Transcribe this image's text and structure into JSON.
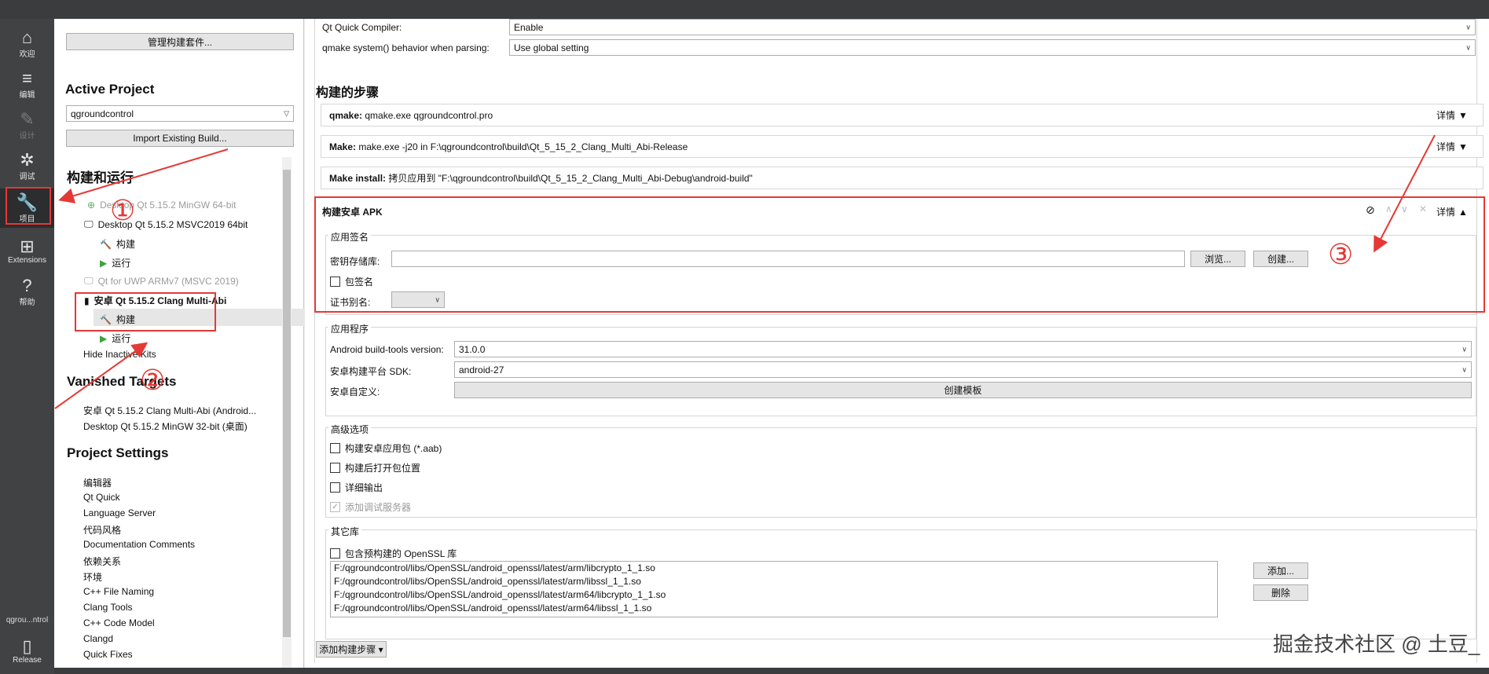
{
  "modes": [
    {
      "label": "欢迎",
      "icon": "home-icon",
      "glyph": "⌂"
    },
    {
      "label": "编辑",
      "icon": "edit-lines-icon",
      "glyph": "≡"
    },
    {
      "label": "设计",
      "icon": "pen-icon",
      "glyph": "✎"
    },
    {
      "label": "调试",
      "icon": "bug-icon",
      "glyph": "✲"
    },
    {
      "label": "项目",
      "icon": "wrench-icon",
      "glyph": "🔧"
    },
    {
      "label": "Extensions",
      "icon": "extensions-icon",
      "glyph": "⊞"
    },
    {
      "label": "帮助",
      "icon": "help-icon",
      "glyph": "?"
    }
  ],
  "target": {
    "project_short": "qgrou...ntrol",
    "config": "Release"
  },
  "left": {
    "manage_kits": "管理构建套件...",
    "active_project_heading": "Active Project",
    "project_combo": "qgroundcontrol",
    "import_build": "Import Existing Build...",
    "build_run_heading": "构建和运行",
    "kits": [
      {
        "label": "Desktop Qt 5.15.2 MinGW 64-bit"
      },
      {
        "label": "Desktop Qt 5.15.2 MSVC2019 64bit"
      },
      {
        "label": "构建"
      },
      {
        "label": "运行"
      },
      {
        "label": "Qt  for UWP ARMv7 (MSVC 2019)"
      },
      {
        "label": "安卓 Qt 5.15.2 Clang Multi-Abi"
      },
      {
        "label": "构建"
      },
      {
        "label": "运行"
      }
    ],
    "hide_inactive": "Hide Inactive Kits",
    "vanished_heading": "Vanished Targets",
    "vanished": [
      "安卓 Qt 5.15.2 Clang Multi-Abi (Android...",
      "Desktop Qt 5.15.2 MinGW 32-bit (桌面)"
    ],
    "project_settings_heading": "Project Settings",
    "settings": [
      "编辑器",
      "Qt Quick",
      "Language Server",
      "代码风格",
      "Documentation Comments",
      "依赖关系",
      "环境",
      "C++ File Naming",
      "Clang Tools",
      "C++ Code Model",
      "Clangd",
      "Quick Fixes"
    ]
  },
  "main": {
    "qt_quick_compiler_label": "Qt Quick Compiler:",
    "qt_quick_compiler_value": "Enable",
    "qmake_system_label": "qmake system() behavior when parsing:",
    "qmake_system_value": "Use global setting",
    "build_steps_heading": "构建的步骤",
    "details": "详情",
    "steps": [
      {
        "name": "qmake:",
        "text": "qmake.exe qgroundcontrol.pro"
      },
      {
        "name": "Make:",
        "text": "make.exe -j20 in F:\\qgroundcontrol\\build\\Qt_5_15_2_Clang_Multi_Abi-Release"
      },
      {
        "name": "Make install:",
        "text": "拷贝应用到 \"F:\\qgroundcontrol\\build\\Qt_5_15_2_Clang_Multi_Abi-Debug\\android-build\""
      }
    ],
    "apk": {
      "title": "构建安卓 APK",
      "signing_group": "应用签名",
      "keystore_label": "密钥存储库:",
      "browse": "浏览...",
      "create": "创建...",
      "sign_package": "包签名",
      "cert_alias": "证书别名:",
      "app_group": "应用程序",
      "build_tools_label": "Android build-tools version:",
      "build_tools_value": "31.0.0",
      "sdk_label": "安卓构建平台 SDK:",
      "sdk_value": "android-27",
      "custom_label": "安卓自定义:",
      "create_templates": "创建模板",
      "advanced_group": "高级选项",
      "opt_aab": "构建安卓应用包 (*.aab)",
      "opt_open": "构建后打开包位置",
      "opt_verbose": "详细输出",
      "opt_debug": "添加调试服务器",
      "libs_group": "其它库",
      "openssl": "包含预构建的 OpenSSL 库",
      "libs": [
        "F:/qgroundcontrol/libs/OpenSSL/android_openssl/latest/arm/libcrypto_1_1.so",
        "F:/qgroundcontrol/libs/OpenSSL/android_openssl/latest/arm/libssl_1_1.so",
        "F:/qgroundcontrol/libs/OpenSSL/android_openssl/latest/arm64/libcrypto_1_1.so",
        "F:/qgroundcontrol/libs/OpenSSL/android_openssl/latest/arm64/libssl_1_1.so"
      ],
      "add": "添加...",
      "remove": "删除"
    },
    "add_step": "添加构建步骤"
  },
  "annotations": [
    "①",
    "②",
    "③"
  ],
  "watermark": "掘金技术社区 @ 土豆_",
  "colors": {
    "annotation": "#e53935",
    "modebar": "#404244"
  }
}
